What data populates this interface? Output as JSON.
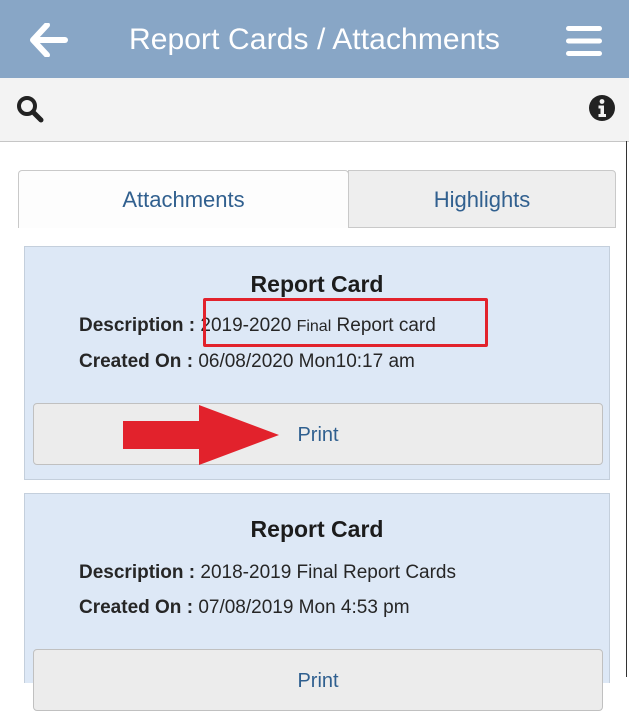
{
  "header": {
    "title": "Report Cards / Attachments",
    "back_icon": "arrow-left-icon",
    "menu_icon": "hamburger-menu-icon"
  },
  "toolbar": {
    "search_icon": "search-icon",
    "info_icon": "info-icon"
  },
  "tabs": [
    {
      "label": "Attachments",
      "active": true
    },
    {
      "label": "Highlights",
      "active": false
    }
  ],
  "cards": [
    {
      "title": "Report Card",
      "description_label": "Description :",
      "description_part1": "2019-2020 ",
      "description_part2": "Final",
      "description_part3": " Report card",
      "created_label": "Created On :",
      "created_value": "06/08/2020 Mon10:17 am",
      "print_label": "Print"
    },
    {
      "title": "Report Card",
      "description_label": "Description :",
      "description_value": "2018-2019 Final Report Cards",
      "created_label": "Created On :",
      "created_value": "07/08/2019 Mon 4:53 pm",
      "print_label": "Print"
    }
  ],
  "annotations": {
    "highlight_color": "#e2222c",
    "arrow_color": "#e2222c"
  },
  "colors": {
    "header_bg": "#88a6c6",
    "card_bg": "#dde8f6",
    "link_blue": "#2f5f8f"
  }
}
